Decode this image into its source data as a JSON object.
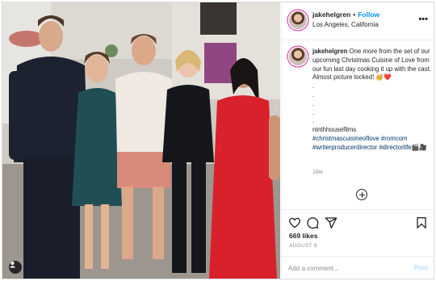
{
  "post": {
    "author": {
      "username": "jakehelgren",
      "follow_label": "Follow",
      "separator": "•",
      "location": "Los Angeles, California"
    },
    "more_icon": "more-options-icon",
    "caption": {
      "username": "jakehelgren",
      "text": "One more from the set of our upcoming Christmas Cuisine of Love from our fun last day cooking it up with the cast. Almost picture locked! 🥳❤️",
      "dots": [
        ".",
        ".",
        ".",
        ".",
        "."
      ],
      "company": "ninthhousefilms",
      "hashtags_line1": "#christmascuisineoflove #romcom",
      "hashtags_line2": "#writerproducerdirector #directorlife🎬🎥"
    },
    "caption_time": "18w",
    "load_more_icon": "plus-circle-icon",
    "actions": {
      "like_icon": "heart-icon",
      "comment_icon": "comment-icon",
      "share_icon": "share-icon",
      "save_icon": "bookmark-icon"
    },
    "likes": "669 likes",
    "date": "AUGUST 9",
    "comment_placeholder": "Add a comment...",
    "post_label": "Post",
    "tagged_icon": "tagged-user-icon"
  }
}
